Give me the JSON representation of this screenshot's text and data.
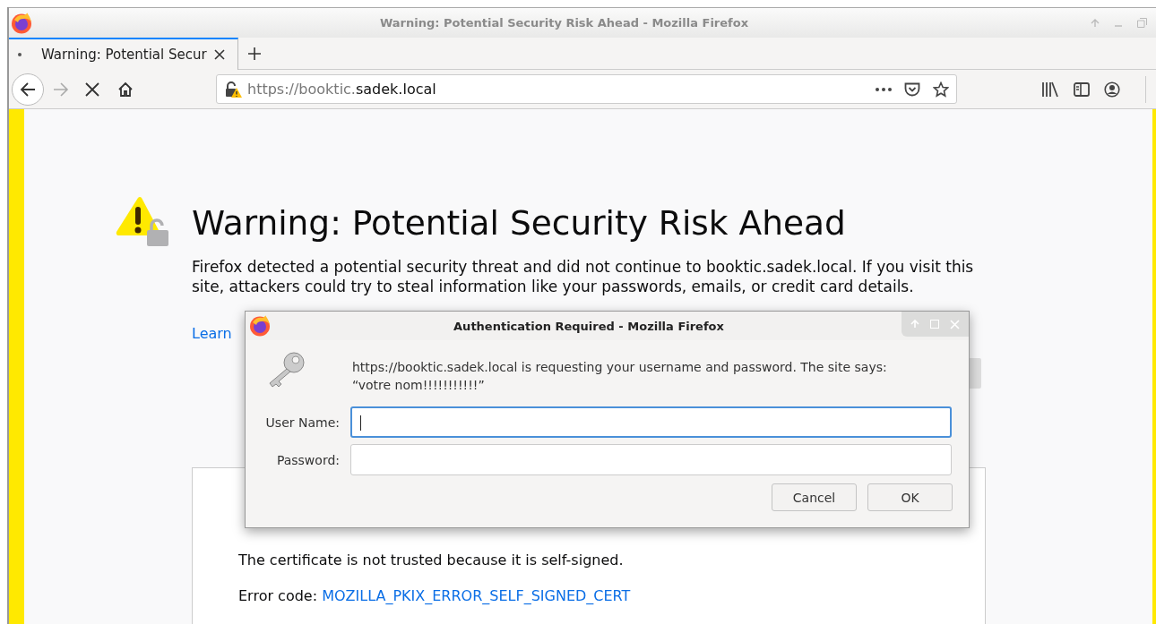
{
  "window": {
    "title": "Warning: Potential Security Risk Ahead - Mozilla Firefox"
  },
  "tabs": [
    {
      "label": "Warning: Potential Secur",
      "selected": true
    }
  ],
  "address_bar": {
    "url_prefix": "https://booktic.",
    "url_domain": "sadek.local"
  },
  "page": {
    "heading": "Warning: Potential Security Risk Ahead",
    "intro": "Firefox detected a potential security threat and did not continue to booktic.sadek.local. If you visit this site, attackers could try to steal information like your passwords, emails, or credit card details.",
    "link": "Learn",
    "details": [
      {
        "kind": "text",
        "text": "The certificate is not trusted because it is self-signed."
      },
      {
        "kind": "code",
        "label": "Error code:",
        "code": "MOZILLA_PKIX_ERROR_SELF_SIGNED_CERT"
      }
    ]
  },
  "dialog": {
    "title": "Authentication Required - Mozilla Firefox",
    "message": "https://booktic.sadek.local is requesting your username and password. The site says:\n“votre nom!!!!!!!!!!!”",
    "fields": [
      {
        "label": "User Name:",
        "focused": true
      },
      {
        "label": "Password:",
        "focused": false
      }
    ],
    "buttons": [
      "Cancel",
      "OK"
    ]
  }
}
